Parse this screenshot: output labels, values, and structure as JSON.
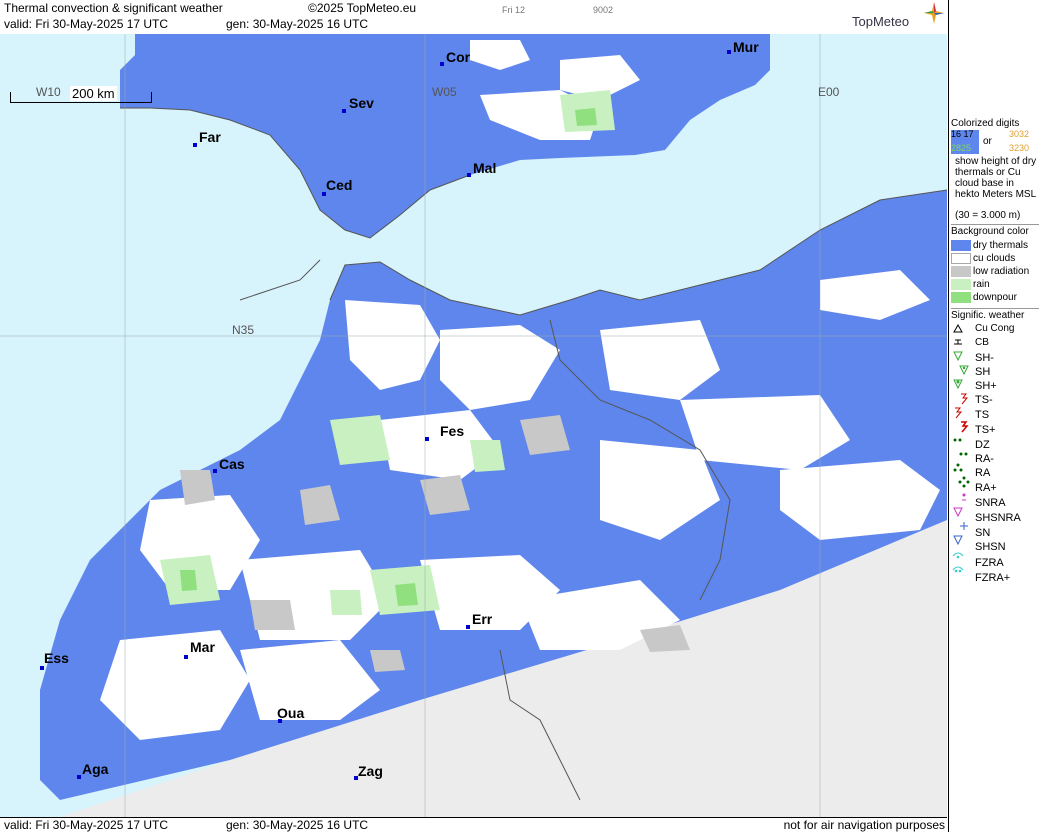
{
  "header": {
    "title": "Thermal convection & significant weather",
    "copyright": "©2025 TopMeteo.eu",
    "valid": "valid:  Fri  30-May-2025  17 UTC",
    "gen": "gen: 30-May-2025 16 UTC",
    "day_code": "Fri 12",
    "code": "9002",
    "logo": "TopMeteo"
  },
  "footer": {
    "valid": "valid:  Fri  30-May-2025  17 UTC",
    "gen": "gen: 30-May-2025 16 UTC",
    "disclaimer": "not for air navigation purposes"
  },
  "map": {
    "scale_label": "200 km",
    "grid_labels": [
      "W10",
      "W05",
      "E00",
      "N35"
    ],
    "cities": [
      "Mur",
      "Cor",
      "Sev",
      "Far",
      "Ced",
      "Mal",
      "Fes",
      "Cas",
      "Mar",
      "Ess",
      "Err",
      "Oua",
      "Aga",
      "Zag"
    ],
    "colors": {
      "sea": "#d7f3fb",
      "dry_thermals": "#5f86ec",
      "cu_clouds": "#ffffff",
      "low_radiation": "#c8c8c8",
      "rain": "#c8f0c0",
      "downpour": "#90e080",
      "no_data": "#ececec"
    }
  },
  "legend": {
    "colorized_title": "Colorized digits",
    "sample_a": "16 17",
    "sample_b": "2825",
    "or_word": "or",
    "sample_c": "3032",
    "sample_d": "3230",
    "description": "show height of dry thermals or Cu cloud base in hekto Meters MSL",
    "example": "(30 = 3.000 m)",
    "bg_title": "Background color",
    "bg_items": [
      "dry thermals",
      "cu clouds",
      "low radiation",
      "rain",
      "downpour"
    ],
    "wx_title": "Signific. weather",
    "wx_items": [
      "Cu Cong",
      "CB",
      "SH-",
      "SH",
      "SH+",
      "TS-",
      "TS",
      "TS+",
      "DZ",
      "RA-",
      "RA",
      "RA+",
      "SNRA",
      "SHSNRA",
      "SN",
      "SHSN",
      "FZRA",
      "FZRA+"
    ]
  }
}
